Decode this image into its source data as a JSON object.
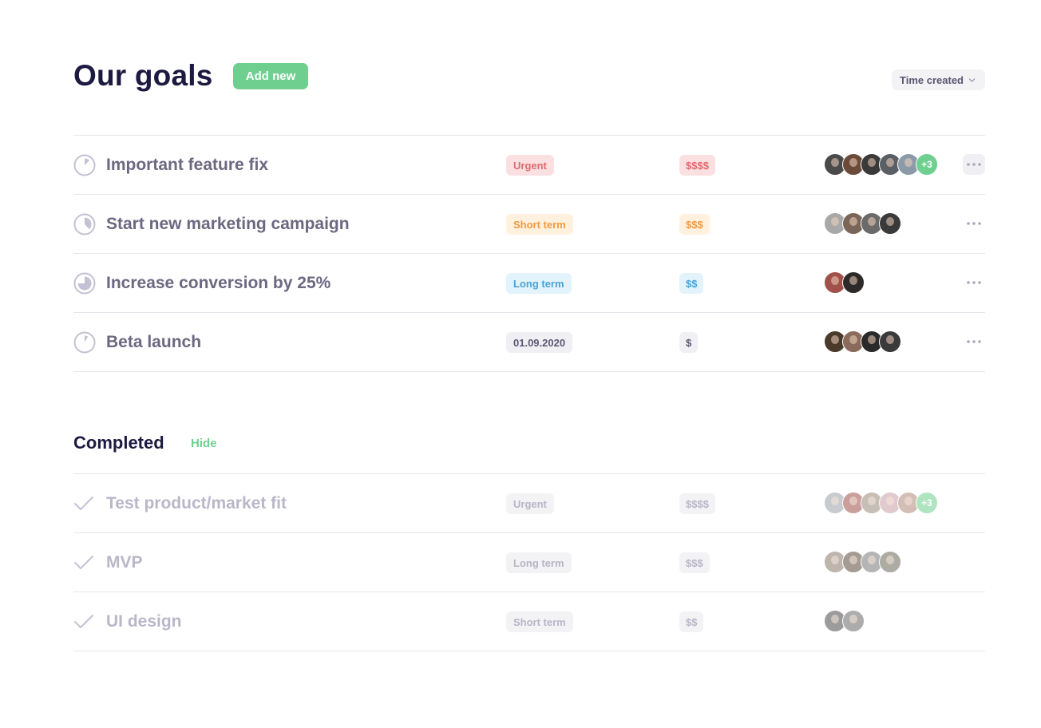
{
  "header": {
    "title": "Our goals",
    "add_button_label": "Add new",
    "sort_label": "Time created"
  },
  "active_goals": [
    {
      "name": "Important feature fix",
      "progress": 0.125,
      "tag": {
        "label": "Urgent",
        "color": "#e06a6e"
      },
      "cost": {
        "label": "$$$$",
        "color": "#e06a6e"
      },
      "avatar_colors": [
        "#4a4a4a",
        "#6b4a3a",
        "#3a3a3a",
        "#5a5f66",
        "#8a9aa8"
      ],
      "extra_members": "+3",
      "menu_active": true
    },
    {
      "name": "Start new marketing campaign",
      "progress": 0.375,
      "tag": {
        "label": "Short term",
        "color": "#f39a3d"
      },
      "cost": {
        "label": "$$$",
        "color": "#f39a3d"
      },
      "avatar_colors": [
        "#a8a8a8",
        "#7a6658",
        "#6a6a6a",
        "#3a3a3a"
      ],
      "extra_members": "",
      "menu_active": false
    },
    {
      "name": "Increase conversion by 25%",
      "progress": 0.75,
      "tag": {
        "label": "Long term",
        "color": "#4ba3d6"
      },
      "cost": {
        "label": "$$",
        "color": "#4ba3d6"
      },
      "avatar_colors": [
        "#a0524a",
        "#2f2a2a"
      ],
      "extra_members": "",
      "menu_active": false
    },
    {
      "name": "Beta launch",
      "progress": 0.08,
      "tag": {
        "label": "01.09.2020",
        "color": "#5b5872"
      },
      "cost": {
        "label": "$",
        "color": "#5b5872"
      },
      "avatar_colors": [
        "#4a3a2a",
        "#8a6a5a",
        "#2a2a2a",
        "#3a3a3a"
      ],
      "extra_members": "",
      "menu_active": false
    }
  ],
  "completed": {
    "title": "Completed",
    "hide_label": "Hide",
    "goals": [
      {
        "name": "Test product/market fit",
        "tag": "Urgent",
        "cost": "$$$$",
        "avatar_colors": [
          "#9aa2aa",
          "#a0524a",
          "#9a8a7a",
          "#c9a0a8",
          "#b08a7a"
        ],
        "extra_members": "+3"
      },
      {
        "name": "MVP",
        "tag": "Long term",
        "cost": "$$$",
        "avatar_colors": [
          "#8a7a6a",
          "#5a4a3a",
          "#7a7a7a",
          "#6a6a5a"
        ],
        "extra_members": ""
      },
      {
        "name": "UI design",
        "tag": "Short term",
        "cost": "$$",
        "avatar_colors": [
          "#4a4a4a",
          "#6a6a6a"
        ],
        "extra_members": ""
      }
    ]
  },
  "colors": {
    "accent": "#6fcf8e",
    "title": "#1c1a40",
    "progress_icon": "#c3c1d3"
  },
  "icons": {
    "progress": "progress-pie-icon",
    "menu": "more-horizontal-icon",
    "check": "check-icon",
    "chevron": "chevron-down-icon"
  }
}
